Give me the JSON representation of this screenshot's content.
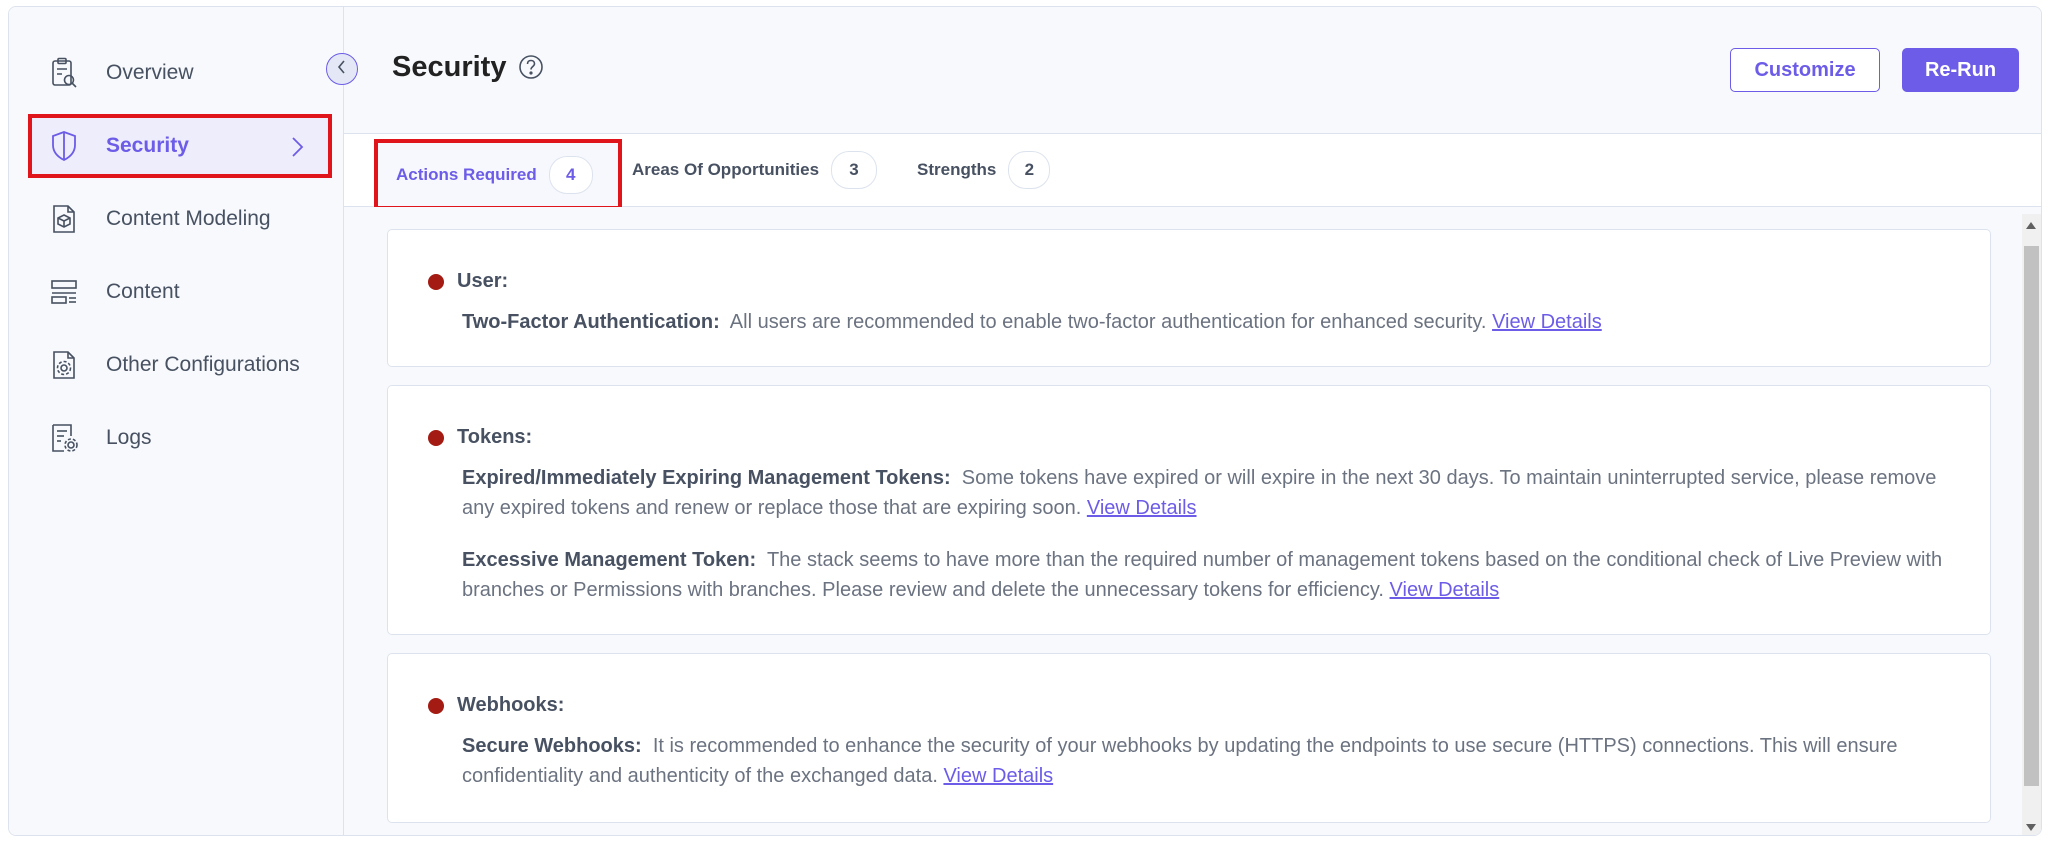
{
  "sidebar": {
    "items": [
      {
        "label": "Overview",
        "icon": "clipboard-search-icon"
      },
      {
        "label": "Security",
        "icon": "shield-icon",
        "active": true
      },
      {
        "label": "Content Modeling",
        "icon": "cube-document-icon"
      },
      {
        "label": "Content",
        "icon": "content-list-icon"
      },
      {
        "label": "Other Configurations",
        "icon": "settings-document-icon"
      },
      {
        "label": "Logs",
        "icon": "log-settings-icon"
      }
    ]
  },
  "header": {
    "title": "Security",
    "customize_label": "Customize",
    "rerun_label": "Re-Run"
  },
  "tabs": [
    {
      "label": "Actions Required",
      "count": "4",
      "active": true
    },
    {
      "label": "Areas Of Opportunities",
      "count": "3"
    },
    {
      "label": "Strengths",
      "count": "2"
    }
  ],
  "sections": [
    {
      "title": "User:",
      "items": [
        {
          "name": "Two-Factor Authentication:",
          "text": "All users are recommended to enable two-factor authentication for enhanced security.",
          "link": "View Details"
        }
      ]
    },
    {
      "title": "Tokens:",
      "items": [
        {
          "name": "Expired/Immediately Expiring Management Tokens:",
          "text": "Some tokens have expired or will expire in the next 30 days. To maintain uninterrupted service, please remove any expired tokens and renew or replace those that are expiring soon.",
          "link": "View Details"
        },
        {
          "name": "Excessive Management Token:",
          "text": "The stack seems to have more than the required number of management tokens based on the conditional check of Live Preview with branches or Permissions with branches. Please review and delete the unnecessary tokens for efficiency.",
          "link": "View Details"
        }
      ]
    },
    {
      "title": "Webhooks:",
      "items": [
        {
          "name": "Secure Webhooks:",
          "text": "It is recommended to enhance the security of your webhooks by updating the endpoints to use secure (HTTPS) connections. This will ensure confidentiality and authenticity of the exchanged data.",
          "link": "View Details"
        }
      ]
    }
  ],
  "colors": {
    "accent": "#6c5ce7",
    "highlight_border": "#e0141b",
    "status_dot": "#a31b12"
  }
}
